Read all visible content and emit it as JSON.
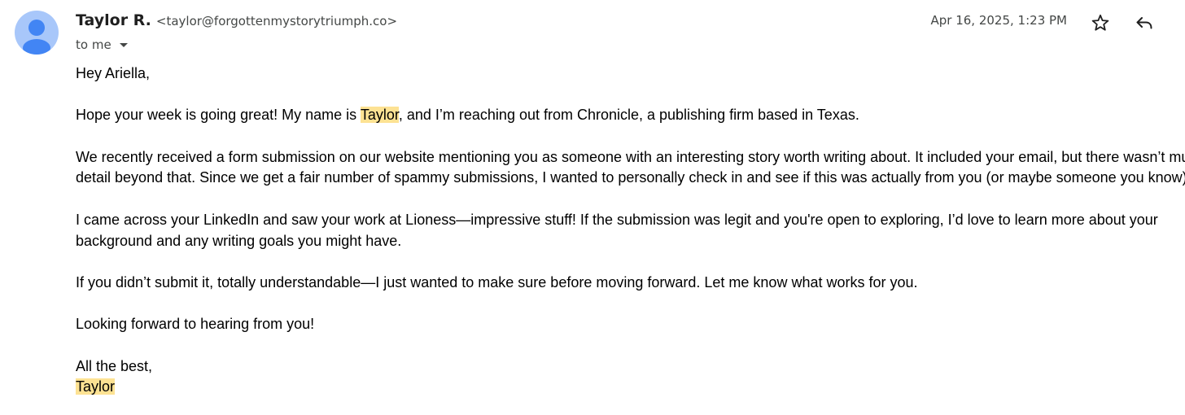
{
  "colors": {
    "highlight": "#fde293",
    "avatar_bg": "#a8c7fa",
    "avatar_fg": "#4285f4"
  },
  "message": {
    "sender_name": "Taylor R.",
    "sender_email": "<taylor@forgottenmystorytriumph.co>",
    "to_label": "to me",
    "date": "Apr 16, 2025, 1:23 PM",
    "icons": {
      "avatar": "person-icon",
      "recipient_details": "chevron-down-icon",
      "star": "star-icon",
      "reply": "reply-icon"
    }
  },
  "body": {
    "greeting": "Hey Ariella,",
    "p1_before": "Hope your week is going great! My name is ",
    "p1_highlight": "Taylor",
    "p1_after": ", and I’m reaching out from Chronicle, a publishing firm based in Texas.",
    "p2_line1": "We recently received a form submission on our website mentioning you as someone with an interesting story worth writing about. It included your email, but there wasn’t much",
    "p2_line2": "detail beyond that. Since we get a fair number of spammy submissions, I wanted to personally check in and see if this was actually from you (or maybe someone you know).",
    "p3_line1": "I came across your LinkedIn and saw your work at Lioness—impressive stuff! If the submission was legit and you're open to exploring, I’d love to learn more about your",
    "p3_line2": "background and any writing goals you might have.",
    "p4": "If you didn’t submit it, totally understandable—I just wanted to make sure before moving forward. Let me know what works for you.",
    "p5": "Looking forward to hearing from you!",
    "closing": "All the best,",
    "signature": "Taylor"
  }
}
